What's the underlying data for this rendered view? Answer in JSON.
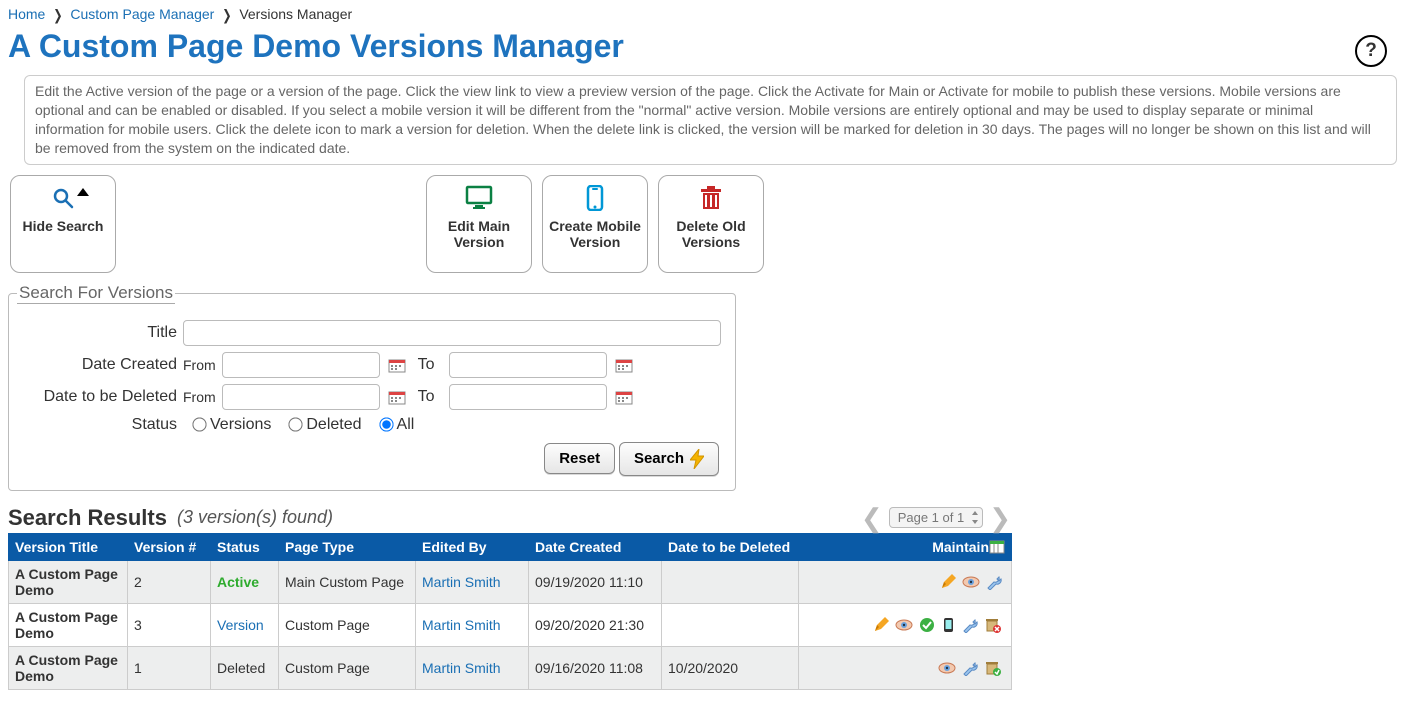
{
  "breadcrumb": {
    "home": "Home",
    "cpm": "Custom Page Manager",
    "current": "Versions Manager"
  },
  "pageTitle": "A Custom Page Demo Versions Manager",
  "infoText": "Edit the Active version of the page or a version of the page. Click the view link to view a preview version of the page. Click the Activate for Main or Activate for mobile to publish these versions. Mobile versions are optional and can be enabled or disabled. If you select a mobile version it will be different from the \"normal\" active version. Mobile versions are entirely optional and may be used to display separate or minimal information for mobile users. Click the delete icon to mark a version for deletion. When the delete link is clicked, the version will be marked for deletion in 30 days. The pages will no longer be shown on this list and will be removed from the system on the indicated date.",
  "actions": {
    "hideSearch": "Hide Search",
    "editMain": "Edit Main Version",
    "createMobile": "Create Mobile Version",
    "deleteOld": "Delete Old Versions"
  },
  "search": {
    "legend": "Search For Versions",
    "titleLabel": "Title",
    "dateCreatedLabel": "Date Created",
    "dateDeletedLabel": "Date to be Deleted",
    "from": "From",
    "to": "To",
    "statusLabel": "Status",
    "optVersions": "Versions",
    "optDeleted": "Deleted",
    "optAll": "All",
    "btnReset": "Reset",
    "btnSearch": "Search"
  },
  "results": {
    "heading": "Search Results",
    "count": "(3 version(s) found)",
    "pagerText": "Page 1 of 1",
    "headers": {
      "title": "Version Title",
      "num": "Version #",
      "status": "Status",
      "type": "Page Type",
      "editedBy": "Edited By",
      "created": "Date Created",
      "toDelete": "Date to be Deleted",
      "maintain": "Maintain"
    },
    "rows": [
      {
        "title": "A Custom Page Demo",
        "num": "2",
        "statusKind": "active",
        "statusText": "Active",
        "type": "Main Custom Page",
        "editedBy": "Martin Smith",
        "created": "09/19/2020 11:10",
        "toDelete": "",
        "maint": [
          "edit",
          "view",
          "settings"
        ]
      },
      {
        "title": "A Custom Page Demo",
        "num": "3",
        "statusKind": "version",
        "statusText": "Version",
        "type": "Custom Page",
        "editedBy": "Martin Smith",
        "created": "09/20/2020 21:30",
        "toDelete": "",
        "maint": [
          "edit",
          "view",
          "approve",
          "mobile",
          "settings",
          "delete"
        ]
      },
      {
        "title": "A Custom Page Demo",
        "num": "1",
        "statusKind": "deleted",
        "statusText": "Deleted",
        "type": "Custom Page",
        "editedBy": "Martin Smith",
        "created": "09/16/2020 11:08",
        "toDelete": "10/20/2020",
        "maint": [
          "view",
          "settings",
          "restore"
        ]
      }
    ]
  }
}
